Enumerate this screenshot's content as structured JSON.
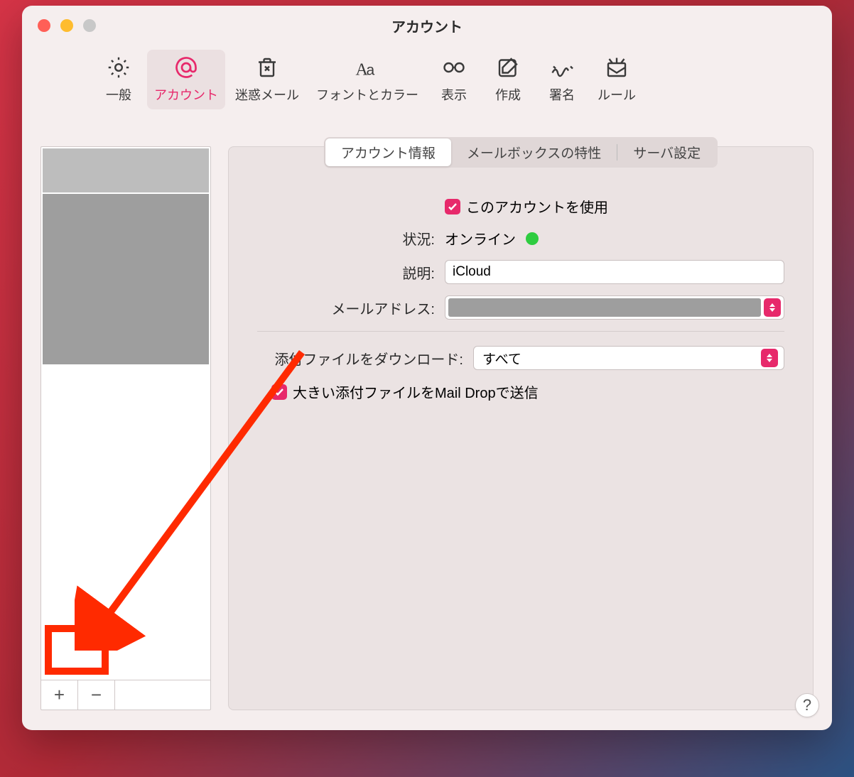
{
  "window": {
    "title": "アカウント"
  },
  "toolbar": {
    "items": [
      {
        "id": "general",
        "label": "一般"
      },
      {
        "id": "accounts",
        "label": "アカウント"
      },
      {
        "id": "junk",
        "label": "迷惑メール"
      },
      {
        "id": "fonts",
        "label": "フォントとカラー"
      },
      {
        "id": "viewing",
        "label": "表示"
      },
      {
        "id": "compose",
        "label": "作成"
      },
      {
        "id": "sign",
        "label": "署名"
      },
      {
        "id": "rules",
        "label": "ルール"
      }
    ],
    "selected": "accounts"
  },
  "tabs": {
    "items": [
      {
        "id": "info",
        "label": "アカウント情報"
      },
      {
        "id": "mailbox",
        "label": "メールボックスの特性"
      },
      {
        "id": "server",
        "label": "サーバ設定"
      }
    ],
    "selected": "info"
  },
  "form": {
    "enable_label": "このアカウントを使用",
    "enable_checked": true,
    "status_label": "状況:",
    "status_value": "オンライン",
    "status_color": "#2ecc40",
    "description_label": "説明:",
    "description_value": "iCloud",
    "email_label": "メールアドレス:",
    "email_value": "",
    "download_label": "添付ファイルをダウンロード:",
    "download_value": "すべて",
    "maildrop_label": "大きい添付ファイルをMail Dropで送信",
    "maildrop_checked": true
  },
  "sidebar": {
    "add_label": "+",
    "remove_label": "−"
  },
  "help_label": "?",
  "colors": {
    "accent": "#e7296b"
  }
}
